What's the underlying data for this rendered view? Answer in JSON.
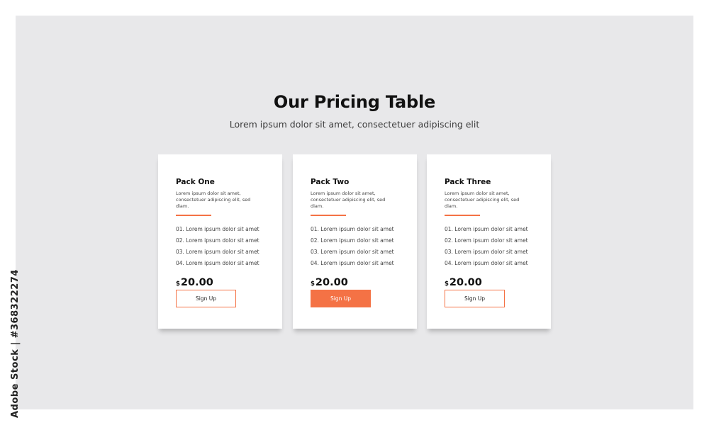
{
  "header": {
    "title": "Our Pricing Table",
    "subtitle": "Lorem ipsum dolor sit amet, consectetuer adipiscing elit"
  },
  "plans": [
    {
      "name": "Pack One",
      "description": "Lorem ipsum dolor sit amet, consectetuer adipiscing elit, sed diam.",
      "features": [
        "01. Lorem ipsum dolor sit amet",
        "02. Lorem ipsum dolor sit amet",
        "03. Lorem ipsum dolor sit amet",
        "04. Lorem ipsum dolor sit amet"
      ],
      "currency": "$",
      "price": "20.00",
      "button_label": "Sign Up"
    },
    {
      "name": "Pack Two",
      "description": "Lorem ipsum dolor sit amet, consectetuer adipiscing elit, sed diam.",
      "features": [
        "01. Lorem ipsum dolor sit amet",
        "02. Lorem ipsum dolor sit amet",
        "03. Lorem ipsum dolor sit amet",
        "04. Lorem ipsum dolor sit amet"
      ],
      "currency": "$",
      "price": "20.00",
      "button_label": "Sign Up"
    },
    {
      "name": "Pack Three",
      "description": "Lorem ipsum dolor sit amet, consectetuer adipiscing elit, sed diam.",
      "features": [
        "01. Lorem ipsum dolor sit amet",
        "02. Lorem ipsum dolor sit amet",
        "03. Lorem ipsum dolor sit amet",
        "04. Lorem ipsum dolor sit amet"
      ],
      "currency": "$",
      "price": "20.00",
      "button_label": "Sign Up"
    }
  ],
  "watermark": {
    "stock_id": "Adobe Stock | #368322274"
  },
  "colors": {
    "accent": "#f47245",
    "background": "#e8e8ea",
    "card": "#ffffff",
    "text": "#111111"
  }
}
